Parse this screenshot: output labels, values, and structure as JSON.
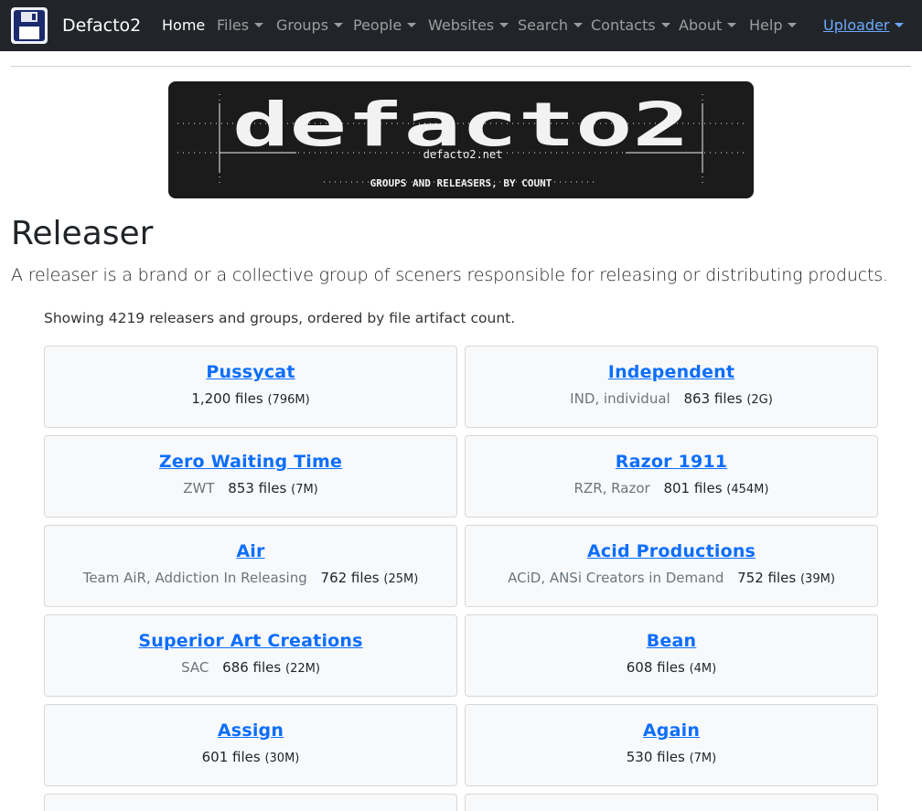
{
  "brand": {
    "name": "Defacto2"
  },
  "nav": {
    "home": "Home",
    "files": "Files",
    "groups": "Groups",
    "people": "People",
    "websites": "Websites",
    "search": "Search",
    "contacts": "Contacts",
    "about": "About",
    "help": "Help",
    "uploader": "Uploader"
  },
  "banner": {
    "logo_text": "defacto2",
    "url": "defacto2.net",
    "subtitle": "GROUPS AND RELEASERS, BY COUNT"
  },
  "page": {
    "title": "Releaser",
    "lead": "A releaser is a brand or a collective group of sceners responsible for releasing or distributing products.",
    "showing": "Showing 4219 releasers and groups, ordered by file artifact count."
  },
  "releasers": [
    {
      "name": "Pussycat",
      "alias": "",
      "files": "1,200 files",
      "size": "(796M)"
    },
    {
      "name": "Independent",
      "alias": "IND, individual",
      "files": "863 files",
      "size": "(2G)"
    },
    {
      "name": "Zero Waiting Time",
      "alias": "ZWT",
      "files": "853 files",
      "size": "(7M)"
    },
    {
      "name": "Razor 1911",
      "alias": "RZR, Razor",
      "files": "801 files",
      "size": "(454M)"
    },
    {
      "name": "Air",
      "alias": "Team AiR, Addiction In Releasing",
      "files": "762 files",
      "size": "(25M)"
    },
    {
      "name": "Acid Productions",
      "alias": "ACiD, ANSi Creators in Demand",
      "files": "752 files",
      "size": "(39M)"
    },
    {
      "name": "Superior Art Creations",
      "alias": "SAC",
      "files": "686 files",
      "size": "(22M)"
    },
    {
      "name": "Bean",
      "alias": "",
      "files": "608 files",
      "size": "(4M)"
    },
    {
      "name": "Assign",
      "alias": "",
      "files": "601 files",
      "size": "(30M)"
    },
    {
      "name": "Again",
      "alias": "",
      "files": "530 files",
      "size": "(7M)"
    }
  ],
  "colors": {
    "navbar": "#212529",
    "link": "#0d6efd",
    "card_bg": "#f8f9fa",
    "uploader": "#6ea8fe"
  }
}
